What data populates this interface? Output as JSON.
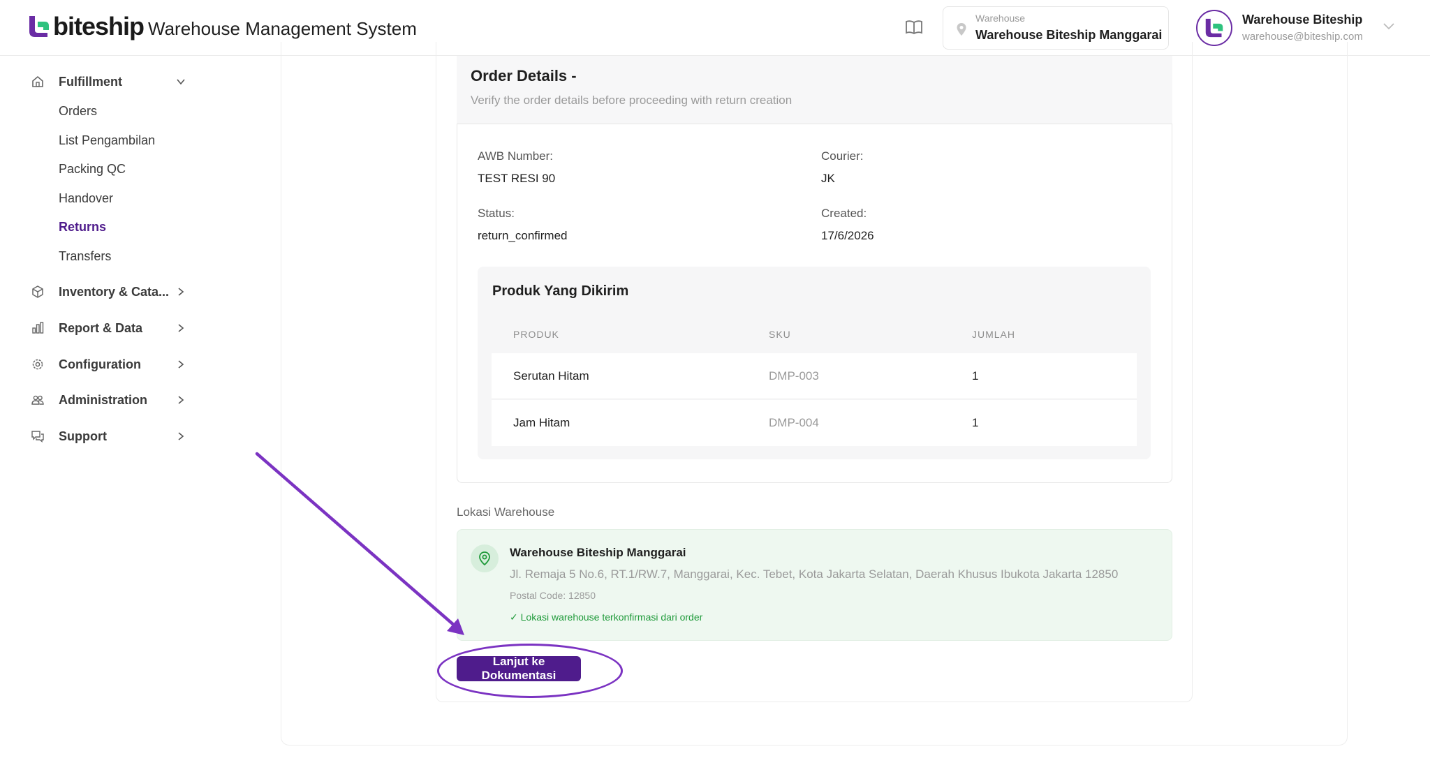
{
  "header": {
    "brand": "biteship",
    "app_title": "Warehouse Management System",
    "warehouse_label": "Warehouse",
    "warehouse_name": "Warehouse Biteship Manggarai",
    "user_name": "Warehouse Biteship",
    "user_email": "warehouse@biteship.com"
  },
  "sidebar": {
    "fulfillment": {
      "label": "Fulfillment",
      "items": [
        "Orders",
        "List Pengambilan",
        "Packing QC",
        "Handover",
        "Returns",
        "Transfers"
      ],
      "active": "Returns"
    },
    "groups": [
      "Inventory & Cata...",
      "Report & Data",
      "Configuration",
      "Administration",
      "Support"
    ]
  },
  "details": {
    "title": "Order Details -",
    "subtitle": "Verify the order details before proceeding with return creation",
    "awb_label": "AWB Number:",
    "awb_value": "TEST RESI 90",
    "courier_label": "Courier:",
    "courier_value": "JK",
    "status_label": "Status:",
    "status_value": "return_confirmed",
    "created_label": "Created:",
    "created_value": "17/6/2026"
  },
  "products": {
    "title": "Produk Yang Dikirim",
    "columns": [
      "PRODUK",
      "SKU",
      "JUMLAH"
    ],
    "rows": [
      {
        "produk": "Serutan Hitam",
        "sku": "DMP-003",
        "jumlah": "1"
      },
      {
        "produk": "Jam Hitam",
        "sku": "DMP-004",
        "jumlah": "1"
      }
    ]
  },
  "location": {
    "section_label": "Lokasi Warehouse",
    "name": "Warehouse Biteship Manggarai",
    "address": "Jl. Remaja 5 No.6, RT.1/RW.7, Manggarai, Kec. Tebet, Kota Jakarta Selatan, Daerah Khusus Ibukota Jakarta 12850",
    "postal": "Postal Code: 12850",
    "confirmed": "✓ Lokasi warehouse terkonfirmasi dari order"
  },
  "actions": {
    "continue_label": "Lanjut ke Dokumentasi"
  },
  "colors": {
    "brand_purple": "#4f1c8c",
    "annotation_purple": "#7b33c2",
    "success_green": "#1f9a3a"
  }
}
